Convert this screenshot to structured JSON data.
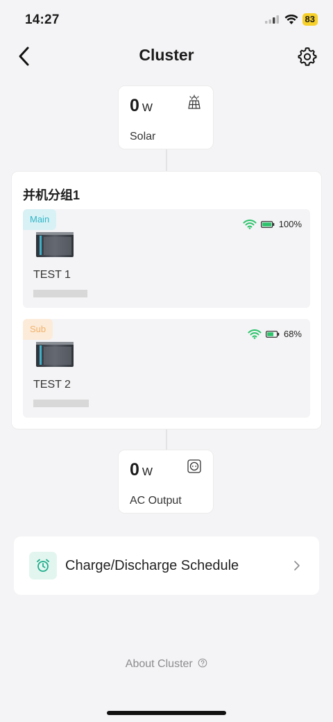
{
  "status_bar": {
    "time": "14:27",
    "battery": "83"
  },
  "nav": {
    "title": "Cluster"
  },
  "solar": {
    "value": "0",
    "unit": "W",
    "label": "Solar"
  },
  "group": {
    "title": "并机分组1",
    "devices": [
      {
        "role": "Main",
        "name": "TEST 1",
        "battery": "100%",
        "battery_level": 1.0
      },
      {
        "role": "Sub",
        "name": "TEST 2",
        "battery": "68%",
        "battery_level": 0.68
      }
    ]
  },
  "ac_output": {
    "value": "0",
    "unit": "W",
    "label": "AC Output"
  },
  "schedule": {
    "label": "Charge/Discharge Schedule"
  },
  "footer": {
    "about": "About Cluster"
  },
  "colors": {
    "accent_teal": "#2fb5c8",
    "wifi_green": "#2cc36b",
    "sub_orange": "#f1b36d",
    "background": "#f4f4f6"
  }
}
